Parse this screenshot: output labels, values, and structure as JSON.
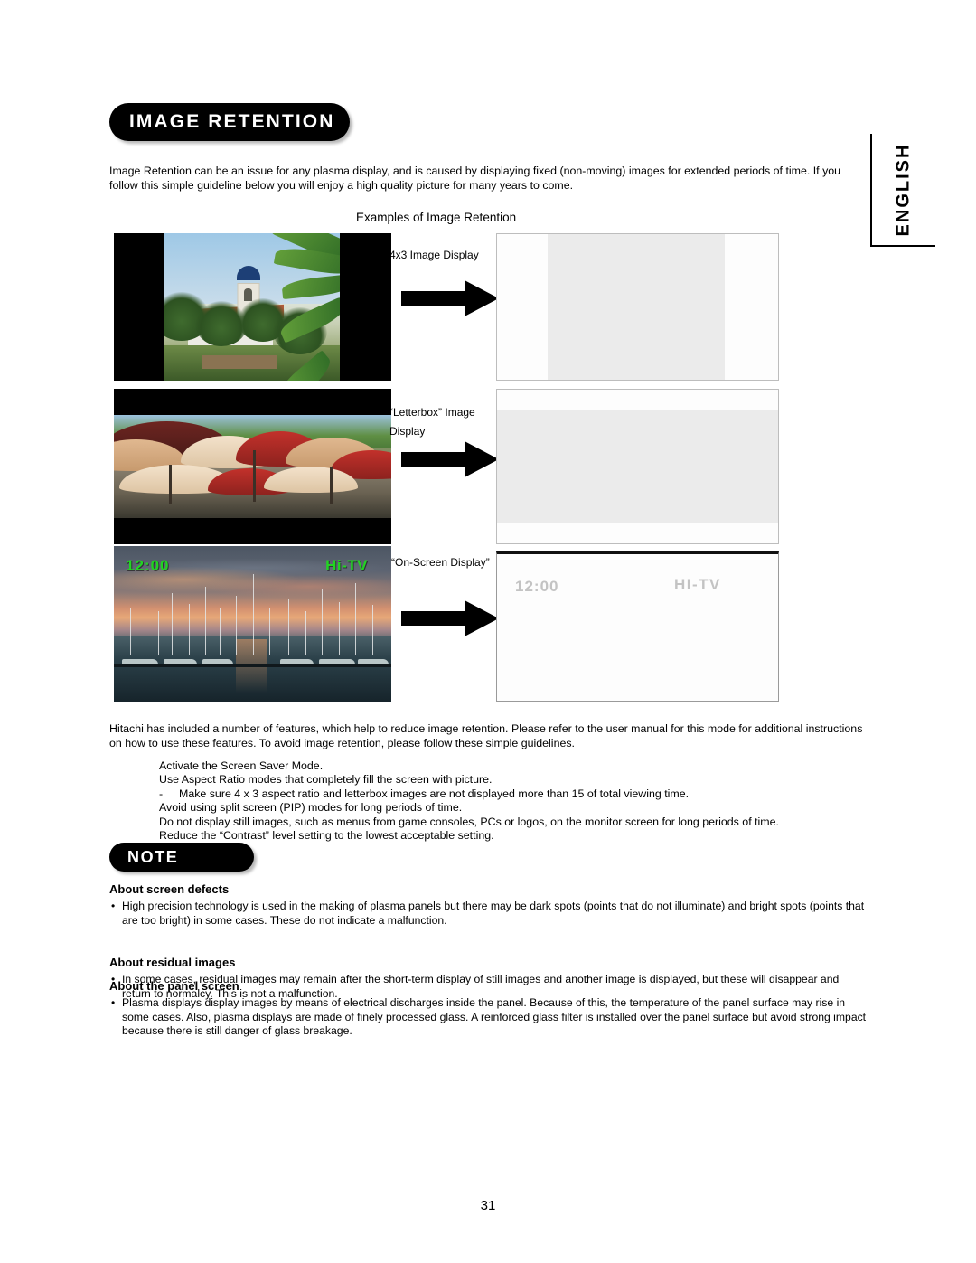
{
  "document": {
    "section_title": "IMAGE RETENTION",
    "language_tab": "ENGLISH",
    "page_number": "31"
  },
  "intro": {
    "paragraph": "Image Retention can be an issue for any plasma display, and is caused by displaying fixed (non-moving) images for extended periods of time. If you follow this simple guideline below you will enjoy a high quality picture for many years to come."
  },
  "examples": {
    "heading": "Examples of Image Retention",
    "rows": [
      {
        "caption": "4x3 Image Display",
        "caption_line2": "",
        "source_type": "pillarbox-photo",
        "source_alt": "4x3 photo of church tower and palm trees with black side bars",
        "result_type": "vertical-band-ghost"
      },
      {
        "caption": "“Letterbox” Image",
        "caption_line2": "Display",
        "source_type": "letterbox-photo",
        "source_alt": "Letterbox photo of market umbrellas with black top and bottom bars",
        "result_type": "horizontal-band-ghost"
      },
      {
        "caption": "“On-Screen Display”",
        "caption_line2": "",
        "source_type": "osd-photo",
        "source_alt": "Marina at sunset with on-screen display overlay",
        "osd_clock": "12:00",
        "osd_channel": "Hi-TV",
        "result_type": "text-ghost",
        "ghost_clock": "12:00",
        "ghost_channel": "HI-TV"
      }
    ]
  },
  "body": {
    "paragraph2": "Hitachi has included a number of features, which help to reduce image retention. Please refer to the user manual for this mode for additional instructions on how to use these features. To avoid image retention, please follow these simple guidelines."
  },
  "guidelines": {
    "items": [
      {
        "marker": "",
        "text": "Activate the Screen Saver Mode."
      },
      {
        "marker": "",
        "text": "Use Aspect Ratio modes that completely fill the screen with picture."
      },
      {
        "marker": "-",
        "text": "Make sure 4 x 3 aspect ratio and letterbox images are not displayed more than 15   of total viewing time."
      },
      {
        "marker": "",
        "text": "Avoid using split screen (PIP) modes for long periods of time."
      },
      {
        "marker": "",
        "text": "Do not display still images, such as menus from game consoles, PCs or logos, on the monitor screen for long periods of time."
      },
      {
        "marker": "",
        "text": "Reduce the “Contrast” level setting to the lowest acceptable setting."
      }
    ]
  },
  "note": {
    "badge": "NOTE",
    "bullet_glyph": "•",
    "sections": [
      {
        "heading": "About screen defects",
        "text": "High precision technology is used in the making of plasma panels but there may be dark spots (points that do not illuminate) and bright spots (points that are too bright) in some cases. These do not indicate a malfunction."
      },
      {
        "heading": "About residual images",
        "text": "In some cases, residual images may remain after the short-term display of still images and another image is displayed, but these will disappear and return to normalcy. This is not a malfunction."
      },
      {
        "heading": "About the panel screen",
        "text": "Plasma displays display images by means of electrical discharges inside the panel. Because of this, the temperature of the panel surface may rise in some cases. Also, plasma displays are made of finely processed glass. A reinforced glass filter is installed over the panel surface but avoid strong impact because there is still danger of glass breakage."
      }
    ]
  }
}
